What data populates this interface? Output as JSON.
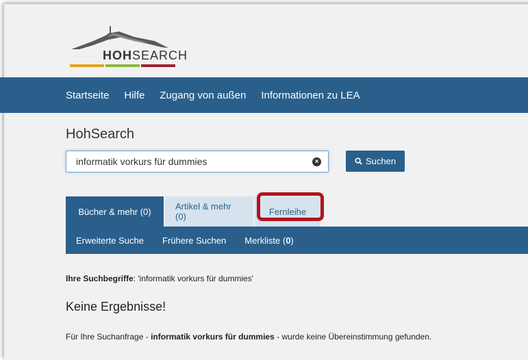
{
  "logo": {
    "brand_bold": "HOH",
    "brand_rest": "SEARCH",
    "bar_colors": [
      "#e0a21b",
      "#8cb63c",
      "#9b2335"
    ]
  },
  "nav": {
    "items": [
      "Startseite",
      "Hilfe",
      "Zugang von außen",
      "Informationen zu LEA"
    ]
  },
  "search": {
    "title": "HohSearch",
    "value": "informatik vorkurs für dummies",
    "button_label": "Suchen"
  },
  "tabs": {
    "books": "Bücher & mehr (0)",
    "articles": "Artikel & mehr (0)",
    "fernleihe": "Fernleihe"
  },
  "subnav": {
    "advanced": "Erweiterte Suche",
    "history": "Frühere Suchen",
    "watchlist_label": "Merkliste (",
    "watchlist_count": "0",
    "watchlist_close": ")"
  },
  "results": {
    "terms_label": "Ihre Suchbegriffe",
    "terms_value": ": 'informatik vorkurs für dummies'",
    "no_results": "Keine Ergebnisse!",
    "msg_prefix": "Für Ihre Suchanfrage - ",
    "msg_query": "informatik vorkurs für dummies",
    "msg_suffix": " - wurde keine Übereinstimmung gefunden."
  },
  "colors": {
    "primary": "#2a5f8c",
    "tab_inactive": "#d6e3ee",
    "highlight": "#b3131c"
  }
}
